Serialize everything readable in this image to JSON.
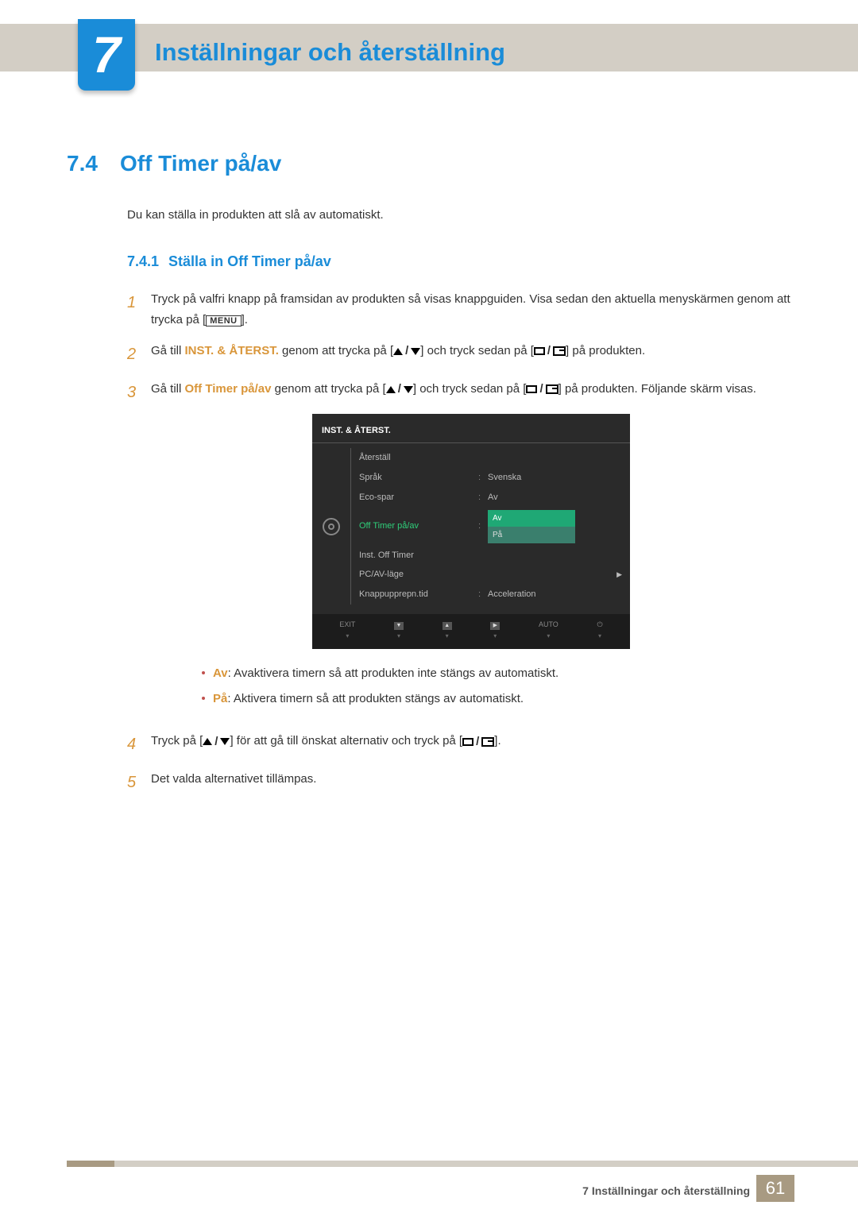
{
  "chapter": {
    "number": "7",
    "title": "Inställningar och återställning"
  },
  "section": {
    "number": "7.4",
    "title": "Off Timer på/av"
  },
  "intro": "Du kan ställa in produkten att slå av automatiskt.",
  "subsection": {
    "number": "7.4.1",
    "title": "Ställa in Off Timer på/av"
  },
  "steps": {
    "s1": {
      "num": "1",
      "text_a": "Tryck på valfri knapp på framsidan av produkten så visas knappguiden. Visa sedan den aktuella menyskärmen genom att trycka på [",
      "menu": "MENU",
      "text_b": "]."
    },
    "s2": {
      "num": "2",
      "text_a": "Gå till ",
      "highlight": "INST. & ÅTERST.",
      "text_b": " genom att trycka på [",
      "text_c": "] och tryck sedan på [",
      "text_d": "] på produkten."
    },
    "s3": {
      "num": "3",
      "text_a": "Gå till ",
      "highlight": "Off Timer på/av",
      "text_b": " genom att trycka på [",
      "text_c": "] och tryck sedan på [",
      "text_d": "] på produkten. Följande skärm visas."
    },
    "s4": {
      "num": "4",
      "text_a": "Tryck på [",
      "text_b": "] för att gå till önskat alternativ och tryck på [",
      "text_c": "]."
    },
    "s5": {
      "num": "5",
      "text": "Det valda alternativet tillämpas."
    }
  },
  "osd": {
    "header": "INST. & ÅTERST.",
    "rows": [
      {
        "label": "Återställ",
        "value": ""
      },
      {
        "label": "Språk",
        "value": "Svenska"
      },
      {
        "label": "Eco-spar",
        "value": "Av"
      },
      {
        "label": "Off Timer på/av",
        "value": ""
      },
      {
        "label": "Inst. Off Timer",
        "value": ""
      },
      {
        "label": "PC/AV-läge",
        "value": ""
      },
      {
        "label": "Knappupprepn.tid",
        "value": "Acceleration"
      }
    ],
    "dropdown": {
      "opt1": "Av",
      "opt2": "På"
    },
    "footer": {
      "exit": "EXIT",
      "auto": "AUTO"
    }
  },
  "bullets": {
    "b1": {
      "label": "Av",
      "text": ": Avaktivera timern så att produkten inte stängs av automatiskt."
    },
    "b2": {
      "label": "På",
      "text": ": Aktivera timern så att produkten stängs av automatiskt."
    }
  },
  "footer": {
    "text": "7 Inställningar och återställning",
    "page": "61"
  }
}
